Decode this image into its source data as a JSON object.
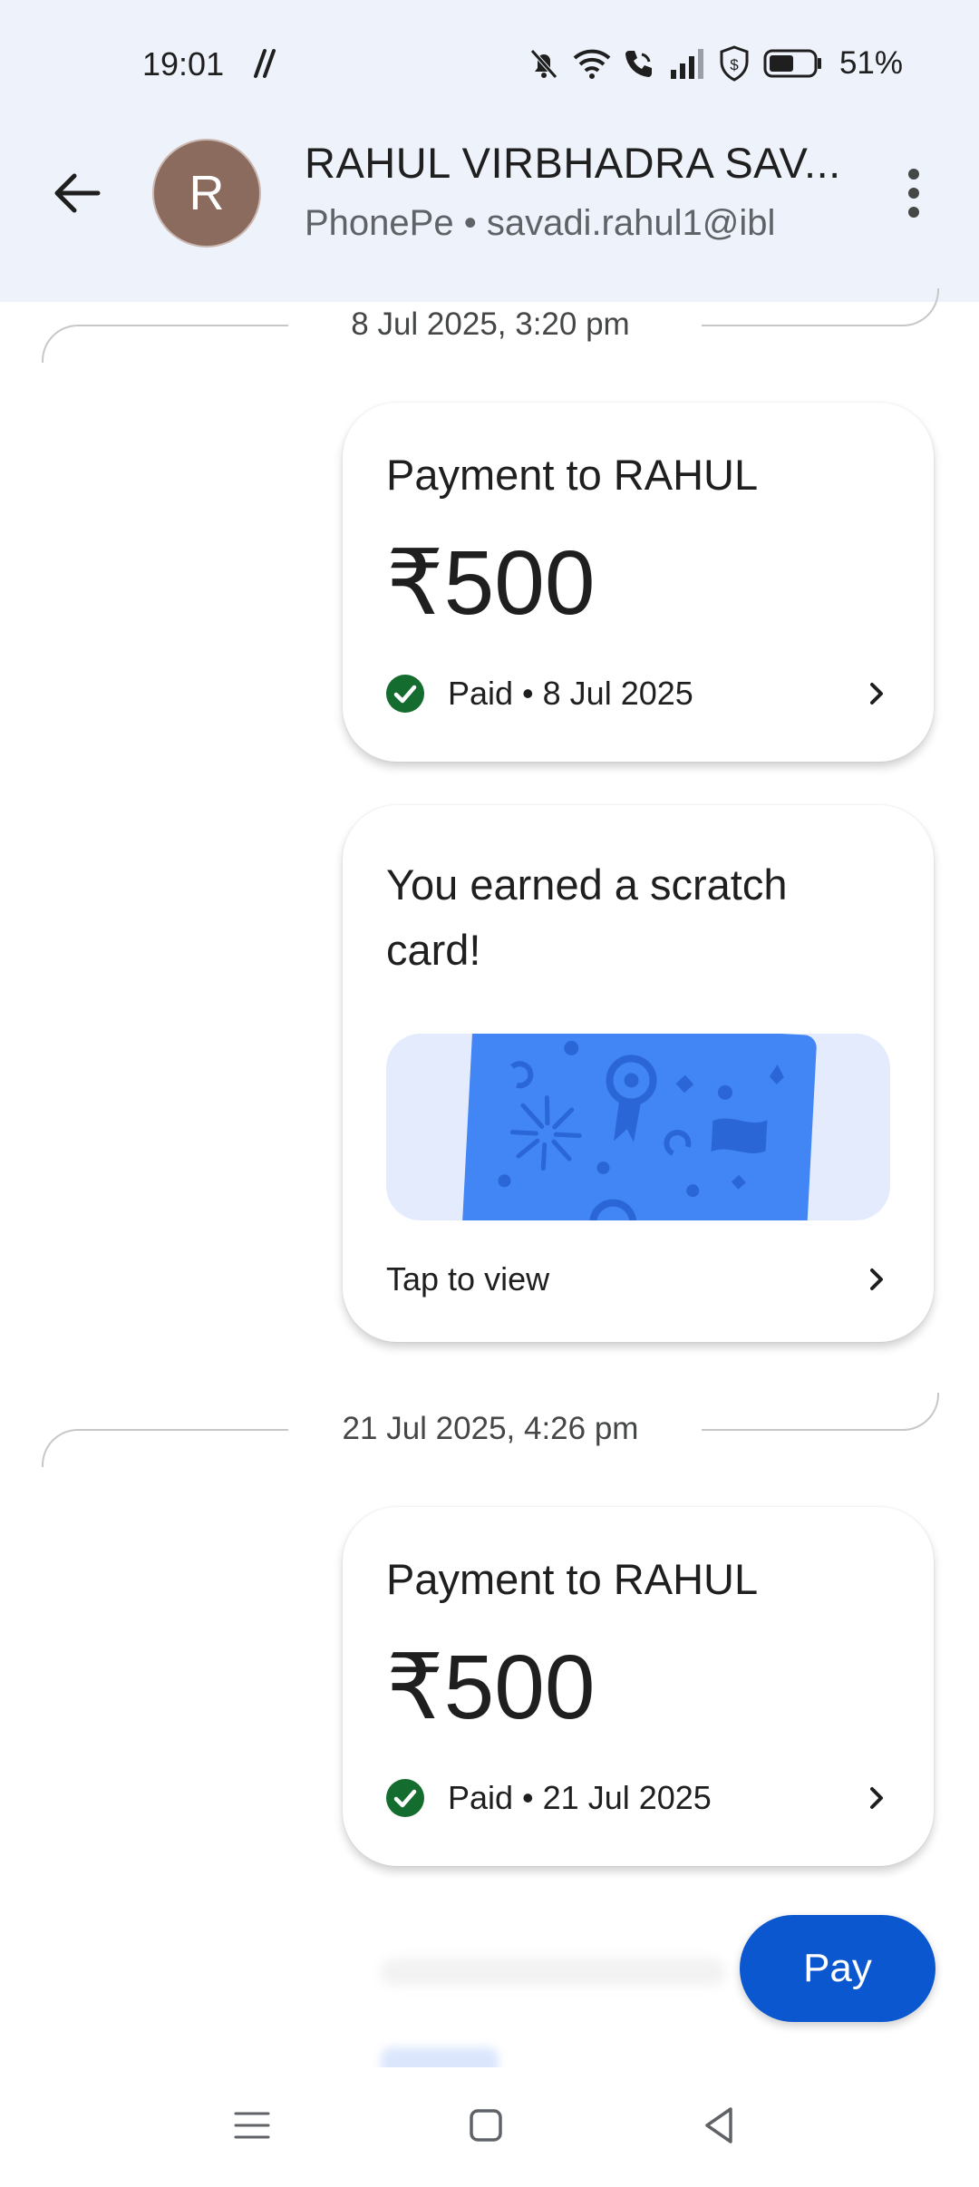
{
  "status_bar": {
    "time": "19:01",
    "battery_pct": "51%"
  },
  "header": {
    "contact_name": "RAHUL VIRBHADRA SAV...",
    "avatar_letter": "R",
    "subtitle": "PhonePe • savadi.rahul1@ibl"
  },
  "thread": {
    "sep1": "8 Jul 2025, 3:20 pm",
    "payment1": {
      "title": "Payment to RAHUL",
      "amount": "₹500",
      "status": "Paid • 8 Jul 2025"
    },
    "scratch": {
      "title": "You earned a scratch card!",
      "action": "Tap to view"
    },
    "sep2": "21 Jul 2025, 4:26 pm",
    "payment2": {
      "title": "Payment to RAHUL",
      "amount": "₹500",
      "status": "Paid • 21 Jul 2025"
    }
  },
  "pay_button": "Pay",
  "colors": {
    "header_bg": "#eef2fa",
    "primary": "#0b57d0",
    "success": "#146c2e",
    "scratch_card": "#4285f4"
  }
}
